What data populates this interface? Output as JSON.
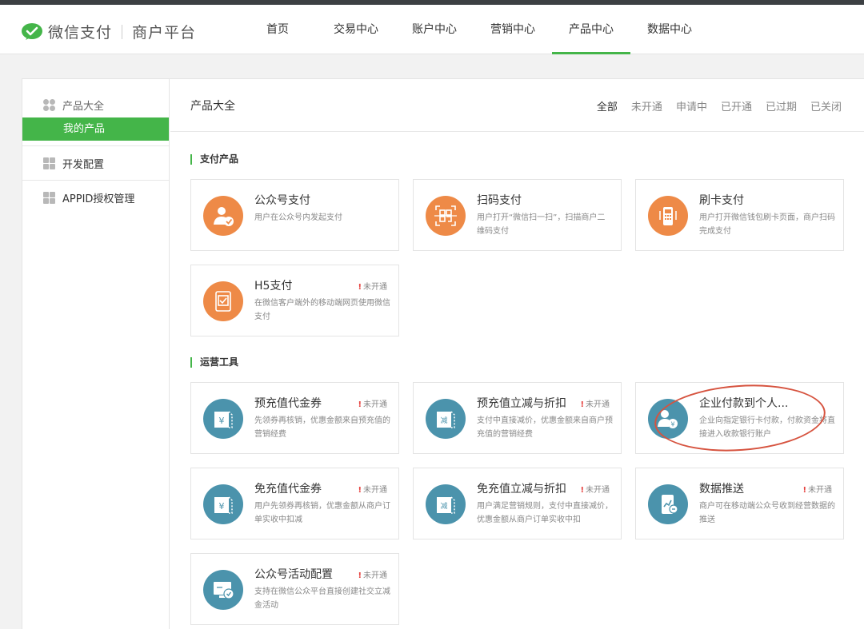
{
  "brand": {
    "name": "微信支付",
    "sub": "商户平台",
    "accent": "#44b549"
  },
  "nav": [
    {
      "label": "首页"
    },
    {
      "label": "交易中心"
    },
    {
      "label": "账户中心"
    },
    {
      "label": "营销中心"
    },
    {
      "label": "产品中心",
      "active": true
    },
    {
      "label": "数据中心"
    }
  ],
  "sidebar": {
    "group1": {
      "label": "产品大全",
      "sub": "我的产品"
    },
    "group2": {
      "label": "开发配置"
    },
    "group3": {
      "label": "APPID授权管理"
    }
  },
  "content": {
    "title": "产品大全",
    "filters": [
      "全部",
      "未开通",
      "申请中",
      "已开通",
      "已过期",
      "已关闭"
    ],
    "sections": [
      {
        "title": "支付产品"
      },
      {
        "title": "运营工具"
      }
    ],
    "cards": [
      {
        "title": "公众号支付",
        "desc": "用户在公众号内发起支付",
        "badge": "",
        "icon": "user-check-icon",
        "color": "#ee8a47"
      },
      {
        "title": "扫码支付",
        "desc": "用户打开“微信扫一扫”，扫描商户二维码支付",
        "badge": "",
        "icon": "qr-scan-icon",
        "color": "#ee8a47"
      },
      {
        "title": "刷卡支付",
        "desc": "用户打开微信钱包刷卡页面，商户扫码完成支付",
        "badge": "",
        "icon": "card-reader-icon",
        "color": "#ee8a47"
      },
      {
        "title": "H5支付",
        "desc": "在微信客户端外的移动端网页使用微信支付",
        "badge": "未开通",
        "icon": "tablet-check-icon",
        "color": "#ee8a47"
      },
      {
        "title": "预充值代金券",
        "desc": "先领券再核销，优惠金额来自预充值的营销经费",
        "badge": "未开通",
        "icon": "yen-coupon-icon",
        "color": "#4b93ac"
      },
      {
        "title": "预充值立减与折扣",
        "desc": "支付中直接减价，优惠金额来自商户预充值的营销经费",
        "badge": "未开通",
        "icon": "discount-coupon-icon",
        "color": "#4b93ac"
      },
      {
        "title": "企业付款到个人...",
        "desc": "企业向指定银行卡付款，付款资金将直接进入收款银行账户",
        "badge": "",
        "icon": "enterprise-pay-icon",
        "color": "#4b93ac"
      },
      {
        "title": "免充值代金券",
        "desc": "用户先领券再核销，优惠金额从商户订单实收中扣减",
        "badge": "未开通",
        "icon": "yen-coupon-icon",
        "color": "#4b93ac"
      },
      {
        "title": "免充值立减与折扣",
        "desc": "用户满足营销规则，支付中直接减价，优惠金额从商户订单实收中扣",
        "badge": "未开通",
        "icon": "discount-coupon-icon",
        "color": "#4b93ac"
      },
      {
        "title": "数据推送",
        "desc": "商户可在移动端公众号收到经营数据的推送",
        "badge": "未开通",
        "icon": "data-push-icon",
        "color": "#4b93ac"
      },
      {
        "title": "公众号活动配置",
        "desc": "支持在微信公众平台直接创建社交立减金活动",
        "badge": "未开通",
        "icon": "campaign-config-icon",
        "color": "#4b93ac"
      }
    ]
  }
}
